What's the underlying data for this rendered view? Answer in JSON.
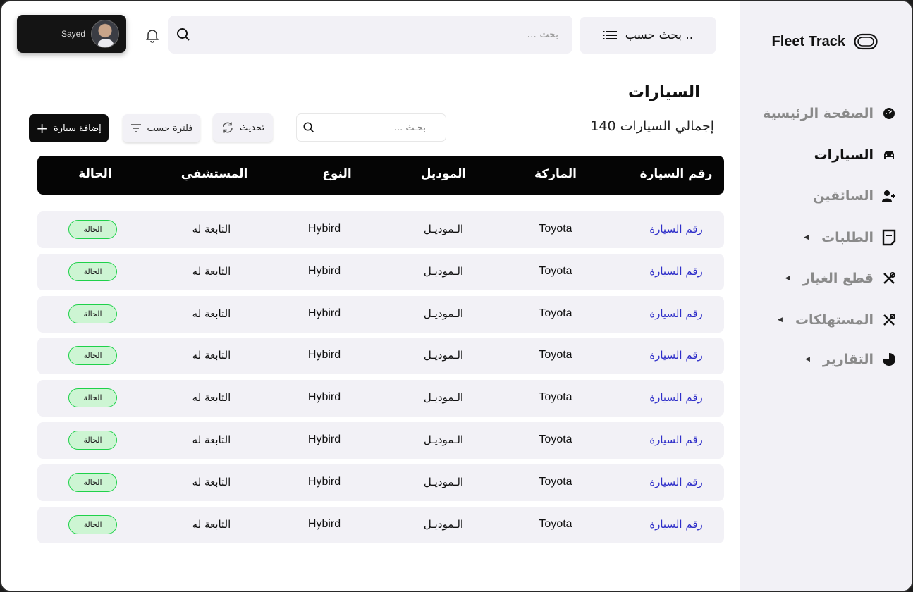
{
  "app": {
    "name": "Fleet Track"
  },
  "user": {
    "name": "Sayed"
  },
  "top_search": {
    "placeholder": "بحث ..."
  },
  "sort_button": {
    "label": "بحث حسب .."
  },
  "sidebar": {
    "items": [
      {
        "label": "الصفحة الرئيسية",
        "icon": "dashboard-gauge-icon",
        "active": false,
        "caret": false
      },
      {
        "label": "السيارات",
        "icon": "car-icon",
        "active": true,
        "caret": false
      },
      {
        "label": "السائقين",
        "icon": "add-user-icon",
        "active": false,
        "caret": false
      },
      {
        "label": "الطلبات",
        "icon": "note-icon",
        "active": false,
        "caret": true
      },
      {
        "label": "قطع الغيار",
        "icon": "tools-icon",
        "active": false,
        "caret": true
      },
      {
        "label": "المستهلكات",
        "icon": "tools-icon",
        "active": false,
        "caret": true
      },
      {
        "label": "التقارير",
        "icon": "pie-chart-icon",
        "active": false,
        "caret": true
      }
    ]
  },
  "page": {
    "title": "السيارات",
    "total_label": "إجمالي السيارات",
    "total_count": "140",
    "search_placeholder": "بحـث ...",
    "refresh_label": "تحديث",
    "filter_label": "فلترة حسب",
    "add_label": "إضافة سيارة"
  },
  "table": {
    "columns": [
      "رقم السيارة",
      "الماركة",
      "الموديل",
      "النوع",
      "المستشفي",
      "الحالة"
    ],
    "rows": [
      [
        "رقم السيارة",
        "Toyota",
        "الـموديـل",
        "Hybird",
        "التابعة له",
        "الحالة"
      ],
      [
        "رقم السيارة",
        "Toyota",
        "الـموديـل",
        "Hybird",
        "التابعة له",
        "الحالة"
      ],
      [
        "رقم السيارة",
        "Toyota",
        "الـموديـل",
        "Hybird",
        "التابعة له",
        "الحالة"
      ],
      [
        "رقم السيارة",
        "Toyota",
        "الـموديـل",
        "Hybird",
        "التابعة له",
        "الحالة"
      ],
      [
        "رقم السيارة",
        "Toyota",
        "الـموديـل",
        "Hybird",
        "التابعة له",
        "الحالة"
      ],
      [
        "رقم السيارة",
        "Toyota",
        "الـموديـل",
        "Hybird",
        "التابعة له",
        "الحالة"
      ],
      [
        "رقم السيارة",
        "Toyota",
        "الـموديـل",
        "Hybird",
        "التابعة له",
        "الحالة"
      ],
      [
        "رقم السيارة",
        "Toyota",
        "الـموديـل",
        "Hybird",
        "التابعة له",
        "الحالة"
      ]
    ]
  },
  "colors": {
    "link": "#2e2ec9",
    "badge_border": "#1fd14a",
    "badge_fill": "#cdf5d3",
    "sidebar_bg": "#f2f1f6"
  }
}
